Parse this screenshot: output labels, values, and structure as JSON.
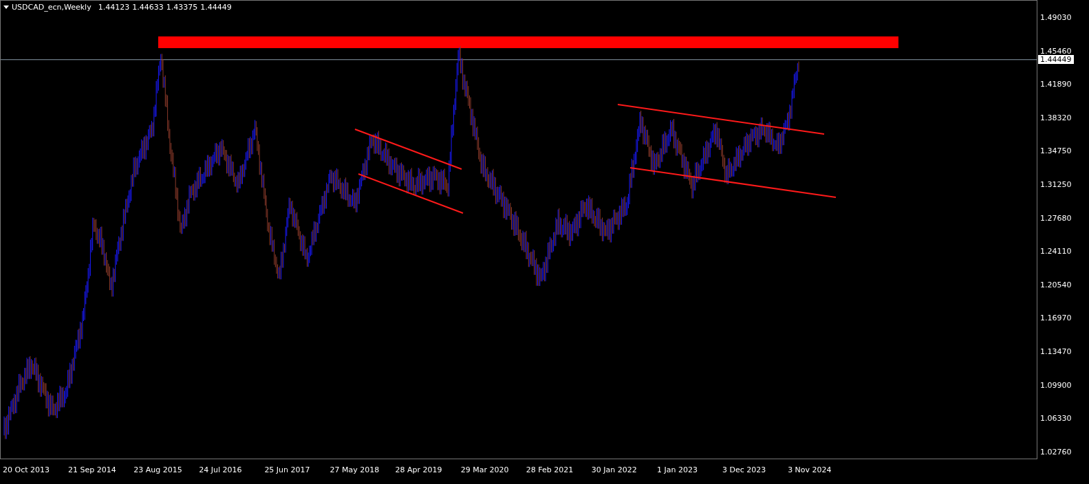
{
  "chart": {
    "symbol": "USDCAD_ecn,Weekly",
    "ohlc": [
      "1.44123",
      "1.44633",
      "1.43375",
      "1.44449"
    ],
    "price_axis": [
      "1.49030",
      "1.45460",
      "1.41890",
      "1.38320",
      "1.34750",
      "1.31250",
      "1.27680",
      "1.24110",
      "1.20540",
      "1.16970",
      "1.13470",
      "1.09900",
      "1.06330",
      "1.02760"
    ],
    "current_price": "1.44449",
    "time_axis": [
      "20 Oct 2013",
      "21 Sep 2014",
      "23 Aug 2015",
      "24 Jul 2016",
      "25 Jun 2017",
      "27 May 2018",
      "28 Apr 2019",
      "29 Mar 2020",
      "28 Feb 2021",
      "30 Jan 2022",
      "1 Jan 2023",
      "3 Dec 2023",
      "3 Nov 2024"
    ]
  }
}
